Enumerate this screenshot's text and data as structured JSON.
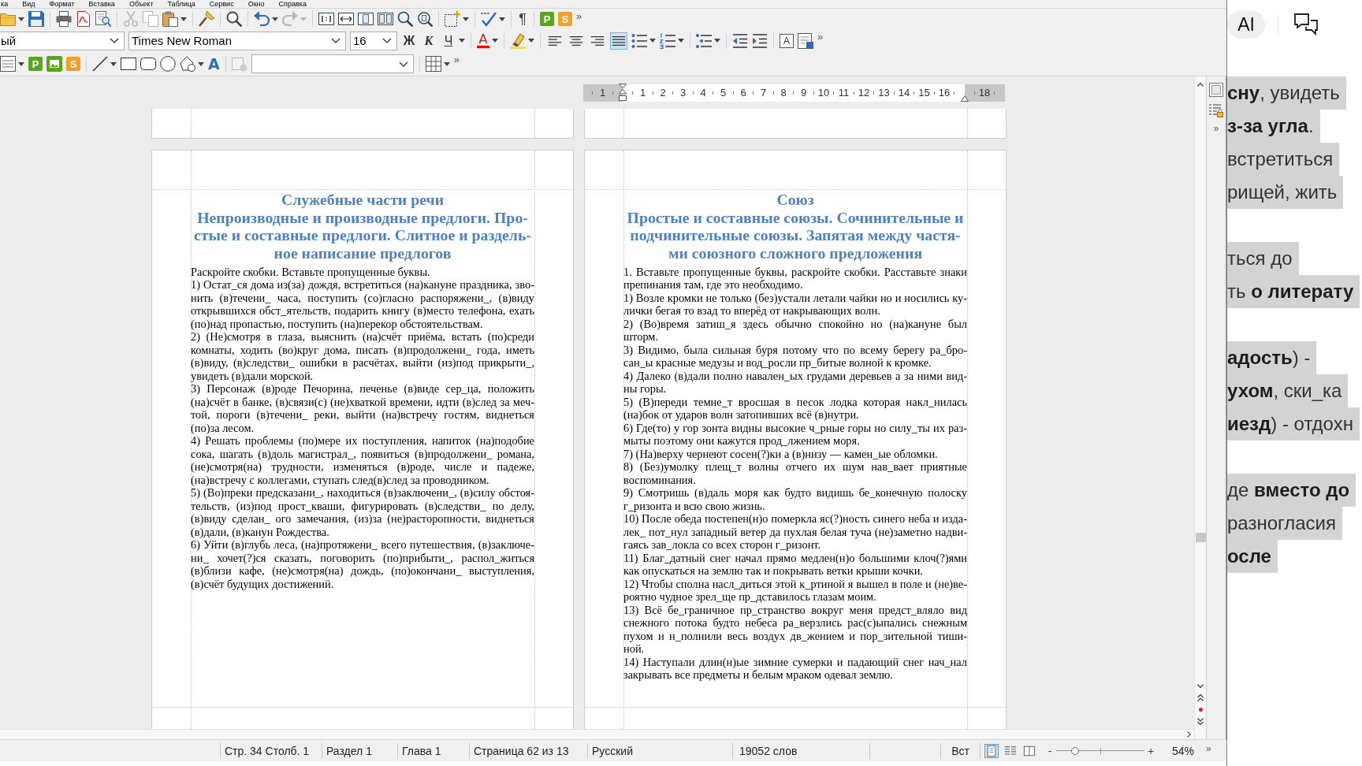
{
  "menu_bar": {
    "items": [
      "ка",
      "Вид",
      "Формат",
      "Вставка",
      "Объект",
      "Таблица",
      "Сервис",
      "Окно",
      "Справка"
    ]
  },
  "standard_toolbar": {
    "clipboard_buttons": [
      {
        "disabled": true
      },
      {
        "disabled": true
      },
      {
        "disabled": false
      }
    ],
    "history_buttons": [
      {
        "disabled": false
      },
      {
        "disabled": true
      }
    ],
    "formatting_marks": "¶",
    "extensions": [
      {
        "glyph": "P",
        "color": "#5aa51c"
      },
      {
        "glyph": "S",
        "color": "#f0a225"
      }
    ],
    "overflow": "»"
  },
  "formatting_toolbar": {
    "paragraph_style": "ый",
    "font_name": "Times New Roman",
    "font_size": "16",
    "style_buttons": [
      "Ж",
      "К",
      "Ч"
    ],
    "font_color": "A",
    "alignment": [
      {
        "selected": false
      },
      {
        "selected": false
      },
      {
        "selected": false
      },
      {
        "selected": true
      }
    ],
    "text_box": "A",
    "overflow": "»"
  },
  "drawing_toolbar": {
    "extensions": [
      {
        "kind": "letter",
        "glyph": "P",
        "color": "#5aa51c"
      },
      {
        "kind": "picture",
        "color": "#5aa51c"
      },
      {
        "kind": "letter",
        "glyph": "S",
        "color": "#f0a225"
      }
    ],
    "fontwork": "A",
    "overflow": "»"
  },
  "ruler": {
    "labels": [
      "1",
      "1",
      "2",
      "3",
      "4",
      "5",
      "6",
      "7",
      "8",
      "9",
      "10",
      "11",
      "12",
      "13",
      "14",
      "15",
      "16",
      "18"
    ]
  },
  "document": {
    "pages": [
      {
        "title": "Служебные части речи",
        "subtitle_lines": [
          "Непроизводные и производные предлоги. Про-",
          "стые и составные предлоги. Слитное и раздель-",
          "ное написание предлогов"
        ],
        "paragraphs": [
          {
            "lines": [
              "Раскройте скобки. Вставьте пропущенные буквы."
            ]
          },
          {
            "lines": [
              "1) Остат_ся дома из(за) дождя, встретиться (на)кануне праздника, зво-",
              "нить (в)течени_ часа, поступить (со)гласно распоряжени_, (в)виду",
              "открывшихся обст_ятельств, подарить книгу (в)место телефона, ехать",
              "(по)над пропастью, поступить (на)перекор обстоятельствам."
            ]
          },
          {
            "lines": [
              "2) (Не)смотря в глаза, выяснить (на)счёт приёма, встать (по)среди",
              "комнаты, ходить (во)круг дома, писать (в)продолжени_ года, иметь",
              "(в)виду, (в)следстви_ ошибки в расчётах, выйти (из)под прикрыти_,",
              "увидеть (в)дали морской."
            ]
          },
          {
            "lines": [
              "3) Персонаж (в)роде Печорина, печенье (в)виде сер_ца, положить",
              "(на)счёт в банке, (в)связи(с) (не)хваткой времени, идти (в)след за меч-",
              "той, пороги (в)течени_ реки, выйти (на)встречу гостям, виднеться",
              "(по)за лесом."
            ]
          },
          {
            "lines": [
              "4) Решать проблемы (по)мере их поступления, напиток (на)подобие",
              "сока, шагать (в)доль магистрал_, появиться (в)продолжени_ романа,",
              "(не)смотря(на) трудности, изменяться (в)роде, числе и падеже,",
              "(на)встречу с коллегами, ступать след(в)след за проводником."
            ]
          },
          {
            "lines": [
              "5) (Во)преки предсказани_, находиться (в)заключени_, (в)силу обстоя-",
              "тельств, (из)под прост_кваши, фигурировать (в)следстви_ по делу,",
              "(в)виду сделан_ ого замечания, (из)за (не)расторопности, виднеться",
              "(в)дали, (в)канун Рождества."
            ]
          },
          {
            "lines": [
              "6) Уйти (в)глубь леса, (на)протяжени_ всего путешествия, (в)заключе-",
              "ни_ хочет(?)ся сказать, поговорить (по)прибыти_, распол_житься",
              "(в)близи кафе, (не)смотря(на) дождь, (по)окончани_ выступления,",
              "(в)счёт будущих достижений."
            ]
          }
        ]
      },
      {
        "title": "Союз",
        "subtitle_lines": [
          "Простые и составные союзы. Сочинительные и",
          "подчинительные союзы. Запятая между частя-",
          "ми союзного сложного предложения"
        ],
        "paragraphs": [
          {
            "lines": [
              "1. Вставьте пропущенные буквы, раскройте скобки. Расставьте знаки",
              "препинания там, где это необходимо."
            ]
          },
          {
            "lines": [
              "1) Возле кромки не только (без)устали летали чайки но и носились ку-",
              "лички бегая то взад то вперёд от накрывающих волн."
            ]
          },
          {
            "lines": [
              "2) (Во)время затиш_я здесь обычно спокойно но (на)кануне был",
              "шторм."
            ]
          },
          {
            "lines": [
              "3) Видимо, была сильная буря потому что по всему берегу ра_бро-",
              "сан_ы красные медузы и вод_росли пр_битые волной к кромке."
            ]
          },
          {
            "lines": [
              "4) Далеко (в)дали полно навален_ых грудами деревьев а за ними вид-",
              "ны горы."
            ]
          },
          {
            "lines": [
              "5) (В)переди темне_т вросшая в песок лодка которая накл_нилась",
              "(на)бок от ударов волн затопивших всё (в)нутри."
            ]
          },
          {
            "lines": [
              "6) Где(то) у гор зонта видны высокие ч_рные горы но силу_ты их раз-",
              "мыты поэтому они кажутся прод_лжением моря."
            ]
          },
          {
            "lines": [
              "7) (На)верху чернеют сосен(?)ки а (в)низу — камен_ые обломки."
            ]
          },
          {
            "lines": [
              "8) (Без)умолку плещ_т волны отчего их шум нав_вает приятные",
              "воспоминания."
            ]
          },
          {
            "lines": [
              "9) Смотришь (в)даль моря как будто видишь бе_конечную полоску",
              "г_ризонта и всю свою жизнь."
            ]
          },
          {
            "lines": [
              "10) После обеда постепен(н)о померкла яс(?)ность синего неба и изда-",
              "лек_ пот_нул западный ветер да пухлая белая туча (не)заметно надви-",
              "гаясь зав_локла со всех сторон г_ризонт."
            ]
          },
          {
            "lines": [
              "11) Благ_датный снег начал прямо медлен(н)о большими клоч(?)ями",
              "как опускаться на землю так и покрывать ветки крыши кочки."
            ]
          },
          {
            "lines": [
              "12) Чтобы сполна насл_диться этой к_ртиной я вышел в поле и (не)ве-",
              "роятно чудное зрел_ще пр_дставилось глазам моим."
            ]
          },
          {
            "lines": [
              "13) Всё бе_граничное пр_странство вокруг меня предст_вляло вид",
              "снежного потока будто небеса ра_верзлись рас(с)ыпались снежным",
              "пухом и н_полнили весь воздух дв_жением и пор_зительной тиши-",
              "ной."
            ]
          },
          {
            "lines": [
              "14) Наступали длин(н)ые зимние сумерки и падающий снег нач_нал",
              "закрывать все предметы и белым мраком одевал землю."
            ]
          }
        ]
      }
    ]
  },
  "sidebar": {
    "overflow": "»"
  },
  "status_bar": {
    "page_position": "Стр. 34 Столб. 1",
    "section": "Раздел 1",
    "chapter": "Глава 1",
    "page_count": "Страница 62 из 13",
    "language": "Русский",
    "word_count": "19052 слов",
    "insert_mode": "Вст",
    "view_layouts": [
      {
        "selected": true
      },
      {
        "selected": false
      },
      {
        "selected": false
      }
    ],
    "zoom_out": "-",
    "zoom_slider": {
      "level": 0.19
    },
    "zoom_in": "+",
    "zoom": "54%",
    "overflow": "»"
  },
  "side_window": {
    "ai_button": "AI",
    "paragraphs": [
      {
        "lines": [
          "**сну**, увидеть",
          "**з-за угла**.",
          "встретиться",
          "рищей, жить"
        ]
      },
      {
        "lines": [
          "ться до",
          "ть **о литерату**"
        ]
      },
      {
        "lines": [
          "**адость**) -",
          "**ухом**, ски_ка",
          "**иезд**) - отдохн"
        ]
      },
      {
        "lines": [
          "де **вместо до**",
          "разногласия",
          "**осле**"
        ]
      }
    ]
  }
}
